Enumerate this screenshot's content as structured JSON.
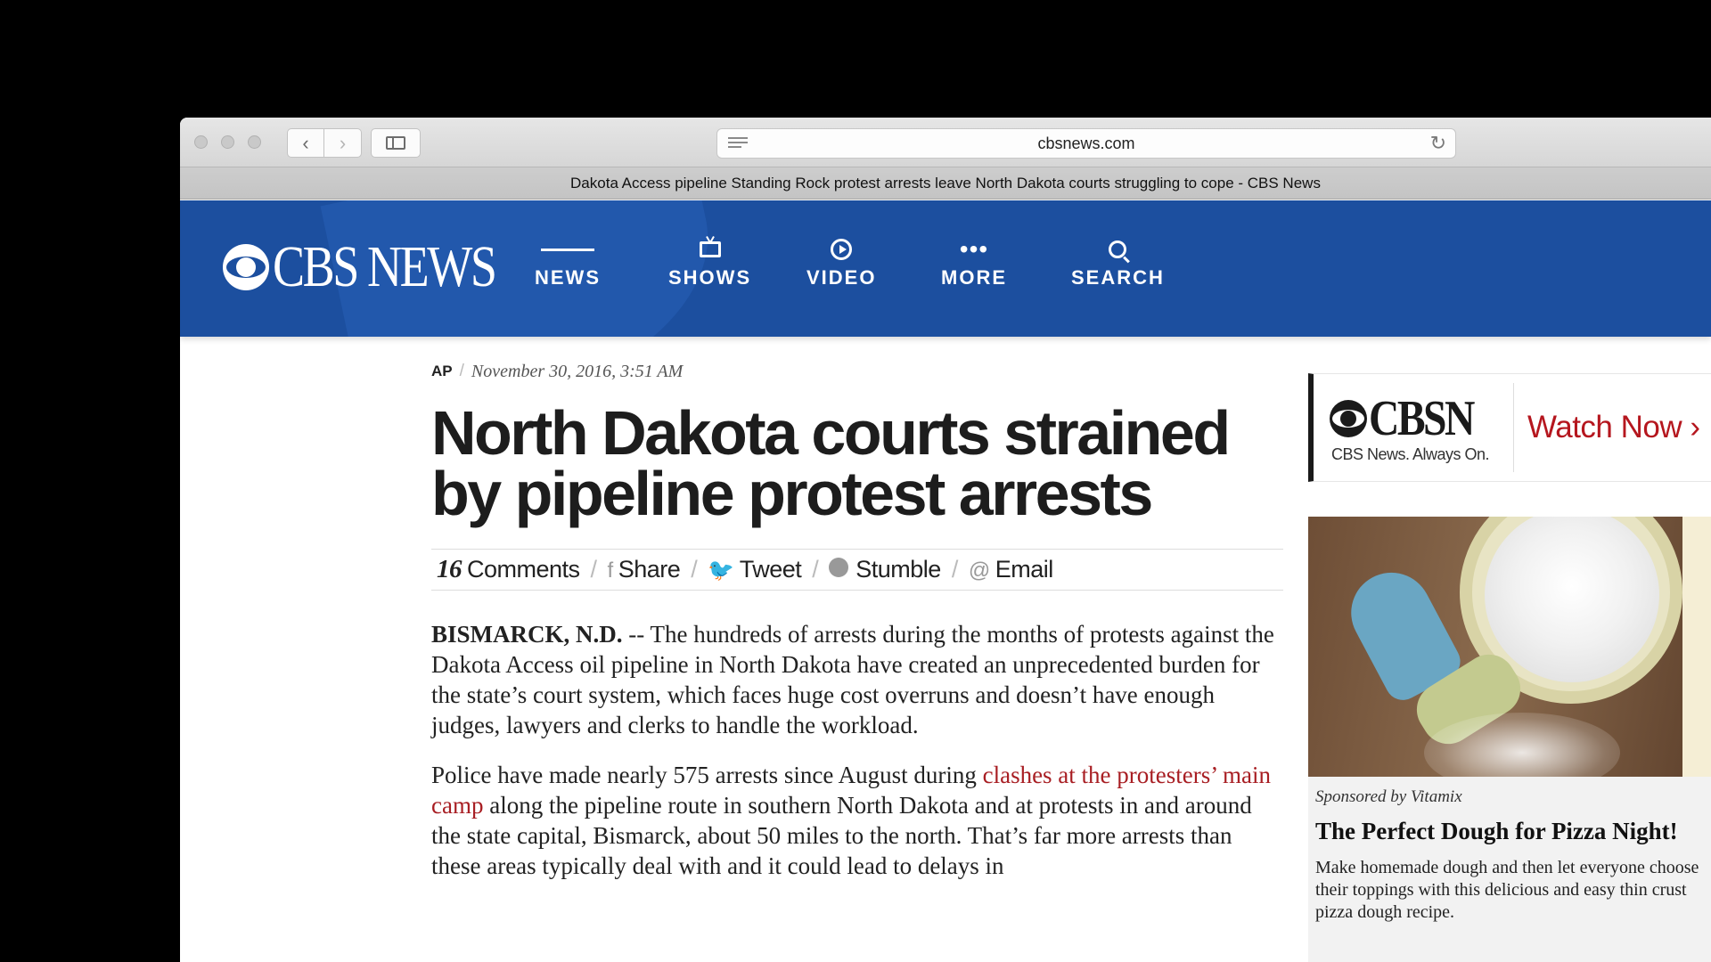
{
  "browser": {
    "url": "cbsnews.com",
    "tab_title": "Dakota Access pipeline Standing Rock protest arrests leave North Dakota courts struggling to cope - CBS News"
  },
  "site": {
    "logo_text": "CBS NEWS",
    "brand_color": "#1c4f9f",
    "nav": [
      {
        "label": "NEWS",
        "icon": "list-icon"
      },
      {
        "label": "SHOWS",
        "icon": "tv-icon"
      },
      {
        "label": "VIDEO",
        "icon": "play-icon"
      },
      {
        "label": "MORE",
        "icon": "more-dots-icon"
      },
      {
        "label": "SEARCH",
        "icon": "search-icon"
      }
    ]
  },
  "article": {
    "source": "AP",
    "separator": "/",
    "date": "November 30, 2016, 3:51 AM",
    "headline": "North Dakota courts strained by pipeline protest arrests",
    "share": {
      "comment_count": "16",
      "comments_label": "Comments",
      "share_label": "Share",
      "tweet_label": "Tweet",
      "stumble_label": "Stumble",
      "email_label": "Email"
    },
    "paragraphs": {
      "p1_lead": "BISMARCK, N.D.",
      "p1_text": " -- The hundreds of arrests during the months of protests against the Dakota Access oil pipeline in North Dakota have created an unprecedented burden for the state’s court system, which faces huge cost overruns and doesn’t have enough judges, lawyers and clerks to handle the workload.",
      "p2_before": "Police have made nearly 575 arrests since August during ",
      "p2_link": "clashes at the protesters’ main camp",
      "p2_after": " along the pipeline route in southern North Dakota and at protests in and around the state capital, Bismarck, about 50 miles to the north. That’s far more arrests than these areas typically deal with and it could lead to delays in"
    },
    "link_color": "#a81e23"
  },
  "rail": {
    "cbsn": {
      "logo": "CBSN",
      "tagline": "CBS News. Always On.",
      "cta": "Watch Now ›",
      "cta_color": "#b5161e"
    },
    "promo": {
      "sponsor": "Sponsored by Vitamix",
      "title": "The Perfect Dough for Pizza Night!",
      "description": "Make homemade dough and then let everyone choose their toppings with this delicious and easy thin crust pizza dough recipe."
    }
  }
}
